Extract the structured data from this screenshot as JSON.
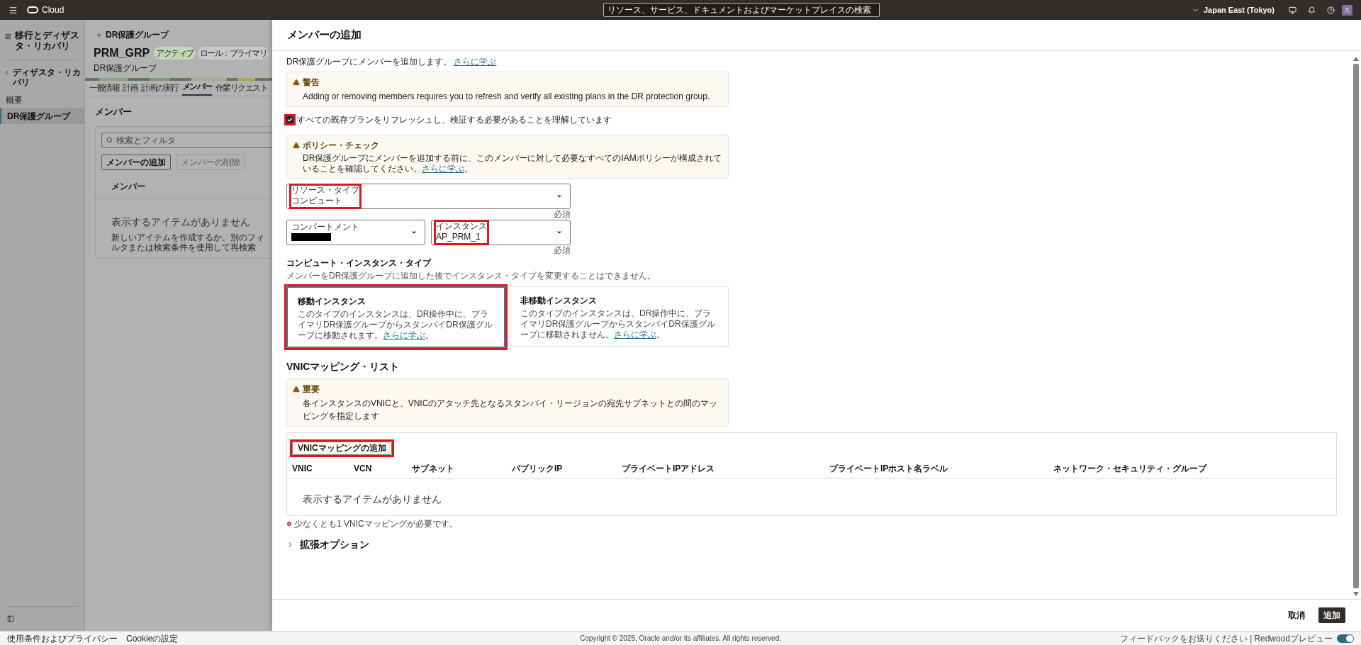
{
  "top_bar": {
    "logo_text": "Cloud",
    "search": {
      "placeholder": "リソース、サービス、ドキュメントおよびマーケットプレイスの検索"
    },
    "region": "Japan East (Tokyo)"
  },
  "sidebar": {
    "title": "移行とディザスタ・リカバリ",
    "back": "ディザスタ・リカバリ",
    "items": [
      {
        "label": "概要",
        "selected": false
      },
      {
        "label": "DR保護グループ",
        "selected": true
      }
    ]
  },
  "page": {
    "breadcrumb": "DR保護グループ",
    "title": "PRM_GRP",
    "badges": [
      {
        "label": "アクティブ",
        "color": "#c3d6b5"
      },
      {
        "label": "ロール：プライマリ",
        "color": "#c9c9c9"
      }
    ],
    "subtitle": "DR保護グループ",
    "tabs": [
      {
        "label": "一般情報",
        "selected": false
      },
      {
        "label": "計画",
        "selected": false
      },
      {
        "label": "計画の実行",
        "selected": false
      },
      {
        "label": "メンバー",
        "selected": true
      },
      {
        "label": "作業リクエスト",
        "selected": false
      }
    ],
    "section_title": "メンバー",
    "search": {
      "placeholder": "検索とフィルタ"
    },
    "buttons": [
      {
        "label": "メンバーの追加",
        "disabled": false
      },
      {
        "label": "メンバーの削除",
        "disabled": true
      }
    ],
    "columns": [
      "メンバー"
    ],
    "empty_title": "表示するアイテムがありません",
    "empty_text": "新しいアイテムを作成するか、別のフィルタまたは検索条件を使用して再検索"
  },
  "drawer": {
    "title": "メンバーの追加",
    "intro": "DR保護グループにメンバーを追加します。",
    "intro_link": "さらに学ぶ",
    "warning": {
      "title": "警告",
      "text": "Adding or removing members requires you to refresh and verify all existing plans in the DR protection group."
    },
    "acknowledge": {
      "label": "すべての既存プランをリフレッシュし、検証する必要があることを理解しています",
      "checked": true,
      "highlighted": true
    },
    "policy": {
      "title": "ポリシー・チェック",
      "text": "DR保護グループにメンバーを追加する前に、このメンバーに対して必要なすべてのIAMポリシーが構成されていることを確認してください。",
      "link": "さらに学ぶ",
      "link_suffix": "。"
    },
    "resource_type": {
      "label": "リソース・タイプ",
      "value": "コンピュート",
      "required": "必須",
      "highlighted": true
    },
    "compartment": {
      "label": "コンパートメント",
      "redacted": true
    },
    "instance": {
      "label": "インスタンス",
      "value": "AP_PRM_1",
      "required": "必須",
      "highlighted": true
    },
    "instance_type": {
      "title": "コンピュート・インスタンス・タイプ",
      "hint": "メンバーをDR保護グループに追加した後でインスタンス・タイプを変更することはできません。",
      "options": [
        {
          "title": "移動インスタンス",
          "text": "このタイプのインスタンスは、DR操作中に、プライマリDR保護グループからスタンバイDR保護グループに移動されます。",
          "link": "さらに学ぶ",
          "link_suffix": "。",
          "selected": true,
          "highlighted": true
        },
        {
          "title": "非移動インスタンス",
          "text": "このタイプのインスタンスは、DR操作中に、プライマリDR保護グループからスタンバイDR保護グループに移動されません。",
          "link": "さらに学ぶ",
          "link_suffix": "。",
          "selected": false,
          "highlighted": false
        }
      ]
    },
    "vnic": {
      "title": "VNICマッピング・リスト",
      "notice": {
        "title": "重要",
        "text": "各インスタンスのVNICと、VNICのアタッチ先となるスタンバイ・リージョンの宛先サブネットとの間のマッピングを指定します"
      },
      "add_button": {
        "label": "VNICマッピングの追加",
        "highlighted": true
      },
      "columns": [
        "VNIC",
        "VCN",
        "サブネット",
        "パブリックIP",
        "プライベートIPアドレス",
        "プライベートIPホスト名ラベル",
        "ネットワーク・セキュリティ・グループ"
      ],
      "empty": "表示するアイテムがありません",
      "error": "少なくとも1 VNICマッピングが必要です。"
    },
    "advanced": {
      "label": "拡張オプション",
      "expanded": false
    },
    "buttons": [
      {
        "label": "取消",
        "kind": "secondary"
      },
      {
        "label": "追加",
        "kind": "primary"
      }
    ]
  },
  "footer": {
    "links": [
      "使用条件およびプライバシー",
      "Cookieの設定"
    ],
    "copyright": "Copyright © 2025, Oracle and/or its affiliates. All rights reserved.",
    "feedback": "フィードバックをお送りください",
    "separator": "|",
    "preview": "Redwoodプレビュー",
    "preview_on": true
  }
}
